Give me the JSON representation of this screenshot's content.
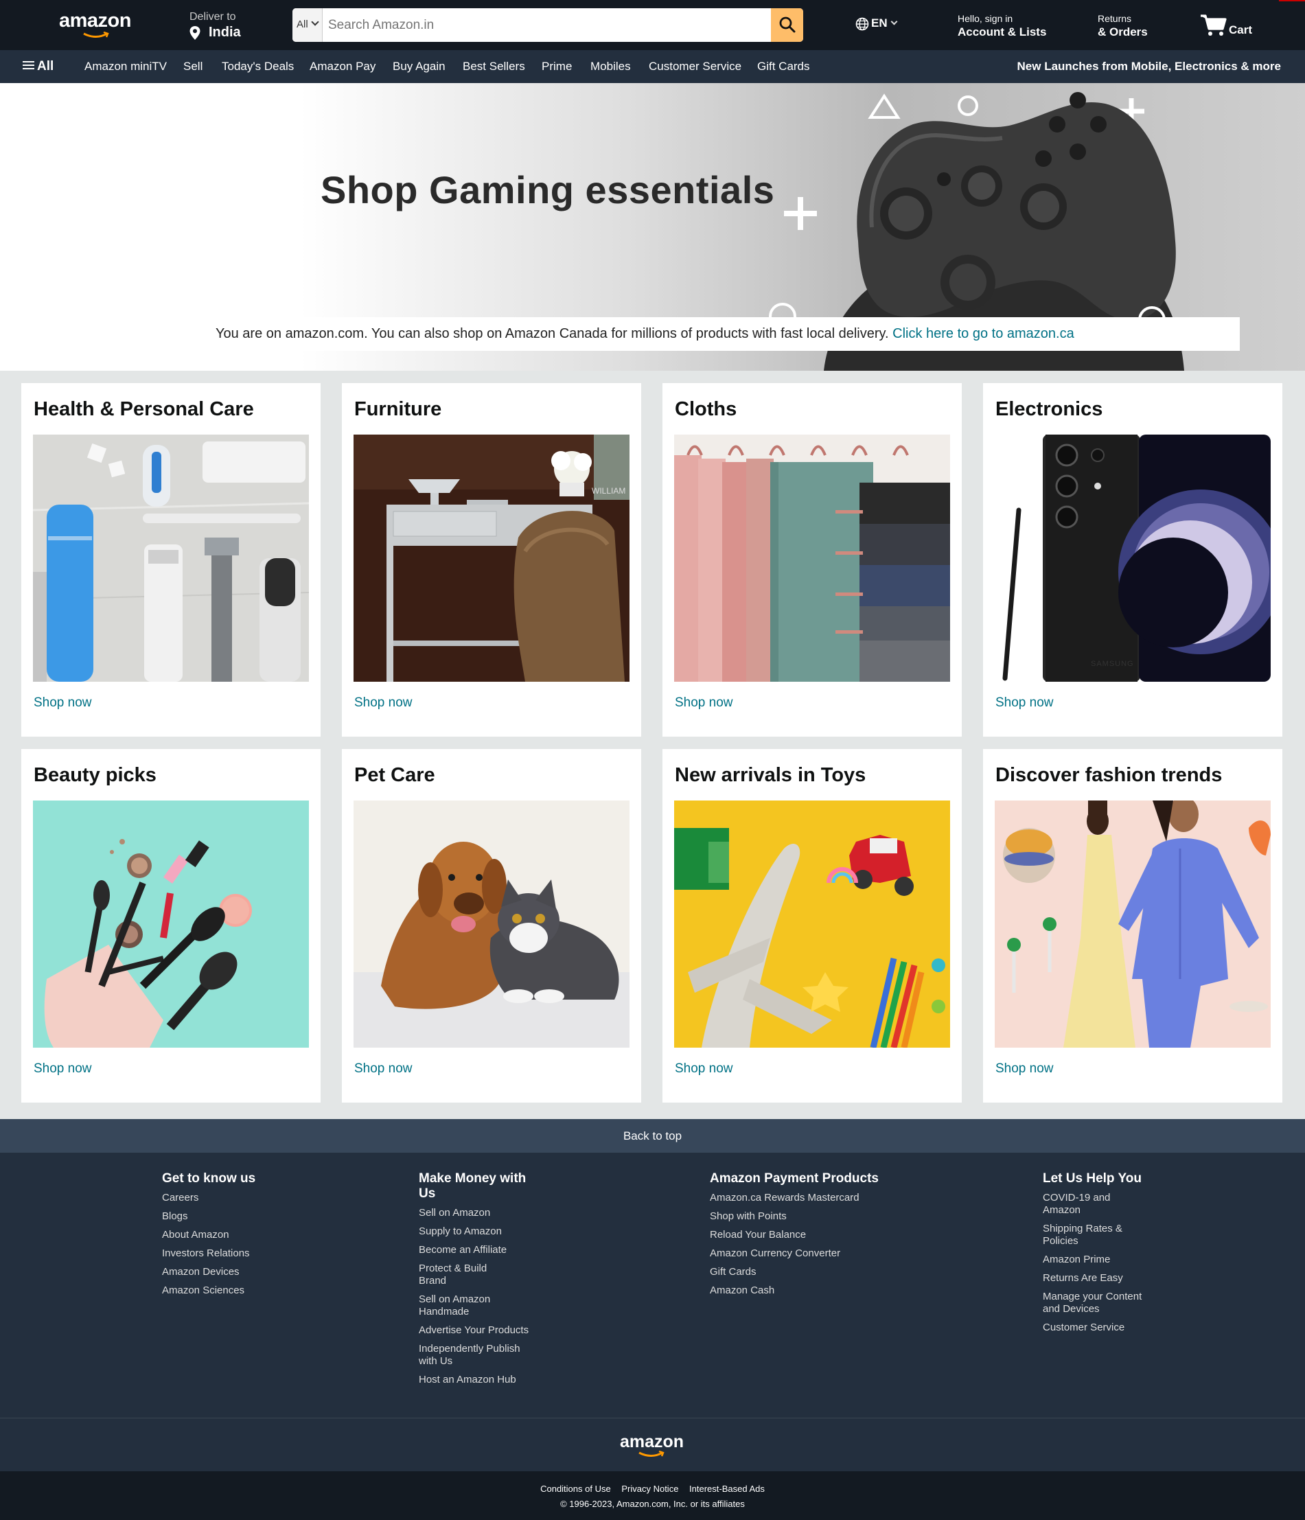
{
  "header": {
    "logo_text": "amazon",
    "deliver_label": "Deliver to",
    "deliver_location": "India",
    "search_category": "All",
    "search_placeholder": "Search Amazon.in",
    "language": "EN",
    "account_line1": "Hello, sign in",
    "account_line2": "Account & Lists",
    "orders_line1": "Returns",
    "orders_line2": "& Orders",
    "cart_label": "Cart"
  },
  "nav": {
    "all_label": "All",
    "items": [
      "Amazon miniTV",
      "Sell",
      "Today's Deals",
      "Amazon Pay",
      "Buy Again",
      "Best Sellers",
      "Prime",
      "Mobiles",
      "Customer Service",
      "Gift Cards"
    ],
    "promo": "New Launches from Mobile, Electronics & more"
  },
  "hero": {
    "title": "Shop Gaming essentials",
    "notice_text": "You are on amazon.com. You can also shop on Amazon Canada for millions of products with fast local delivery. ",
    "notice_link": "Click here to go to amazon.ca"
  },
  "cards": [
    {
      "title": "Health & Personal Care",
      "cta": "Shop now"
    },
    {
      "title": "Furniture",
      "cta": "Shop now"
    },
    {
      "title": "Cloths",
      "cta": "Shop now"
    },
    {
      "title": "Electronics",
      "cta": "Shop now"
    },
    {
      "title": "Beauty picks",
      "cta": "Shop now"
    },
    {
      "title": "Pet Care",
      "cta": "Shop now"
    },
    {
      "title": "New arrivals in Toys",
      "cta": "Shop now"
    },
    {
      "title": "Discover fashion trends",
      "cta": "Shop now"
    }
  ],
  "images": {
    "electronics_phone_brand": "SAMSUNG",
    "furniture_art_text": "WILLIAM"
  },
  "footer": {
    "back_to_top": "Back to top",
    "columns": [
      {
        "title": "Get to know us",
        "links": [
          "Careers",
          "Blogs",
          "About Amazon",
          "Investors Relations",
          "Amazon Devices",
          "Amazon Sciences"
        ]
      },
      {
        "title": "Make Money with Us",
        "links": [
          "Sell on Amazon",
          "Supply to Amazon",
          "Become an Affiliate",
          "Protect & Build Brand",
          "Sell on Amazon Handmade",
          "Advertise Your Products",
          "Independently Publish with Us",
          "Host an Amazon Hub"
        ]
      },
      {
        "title": "Amazon Payment Products",
        "links": [
          "Amazon.ca Rewards Mastercard",
          "Shop with Points",
          "Reload Your Balance",
          "Amazon Currency Converter",
          "Gift Cards",
          "Amazon Cash"
        ]
      },
      {
        "title": "Let Us Help You",
        "links": [
          "COVID-19 and Amazon",
          "Shipping Rates & Policies",
          "Amazon Prime",
          "Returns Are Easy",
          "Manage your Content and Devices",
          "Customer Service"
        ]
      }
    ],
    "logo_text": "amazon",
    "legal_links": [
      "Conditions of Use",
      "Privacy Notice",
      "Interest-Based Ads"
    ],
    "copyright": "© 1996-2023, Amazon.com, Inc. or its affiliates"
  },
  "colors": {
    "header_bg": "#131921",
    "nav_bg": "#232f3e",
    "search_button": "#febd69",
    "link": "#007185",
    "logo_smile": "#ff9900"
  },
  "icons": [
    "location-pin-icon",
    "search-icon",
    "globe-icon",
    "chevron-down-icon",
    "cart-icon",
    "hamburger-icon"
  ]
}
